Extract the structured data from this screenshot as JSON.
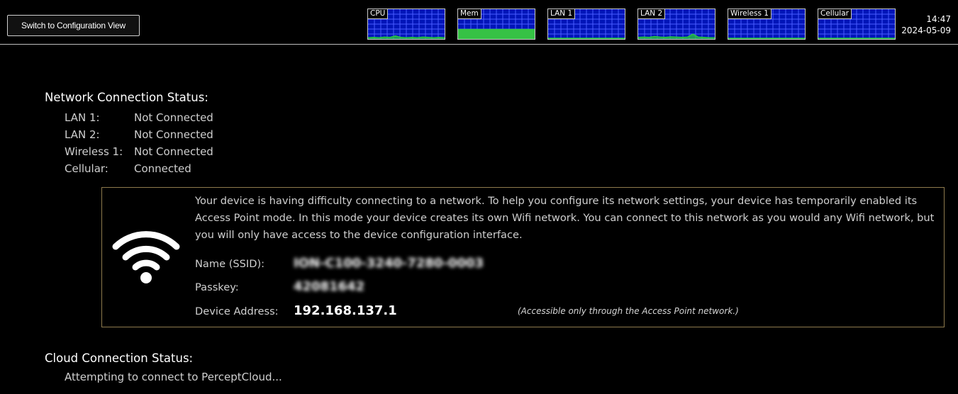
{
  "topbar": {
    "switch_button_label": "Switch to Configuration View",
    "clock": {
      "time": "14:47",
      "date": "2024-05-09"
    },
    "monitors": [
      {
        "label": "CPU",
        "usage_series": [
          2,
          3,
          2,
          4,
          3,
          8,
          3,
          2,
          3,
          2,
          4,
          3,
          2,
          3,
          2
        ]
      },
      {
        "label": "Mem",
        "usage_series": [
          30,
          30,
          30,
          30,
          30,
          30,
          30,
          30,
          30,
          30,
          30,
          30,
          30,
          30,
          30
        ]
      },
      {
        "label": "LAN 1",
        "usage_series": [
          0,
          0,
          0,
          0,
          0,
          0,
          0,
          0,
          0,
          0,
          0,
          0,
          0,
          0,
          0
        ]
      },
      {
        "label": "LAN 2",
        "usage_series": [
          3,
          4,
          3,
          6,
          4,
          3,
          5,
          4,
          3,
          4,
          14,
          4,
          3,
          2,
          2
        ]
      },
      {
        "label": "Wireless 1",
        "usage_series": [
          0,
          0,
          0,
          0,
          0,
          0,
          0,
          0,
          0,
          0,
          0,
          0,
          0,
          0,
          0
        ]
      },
      {
        "label": "Cellular",
        "usage_series": [
          0,
          0,
          0,
          0,
          0,
          0,
          0,
          0,
          0,
          0,
          0,
          0,
          0,
          0,
          0
        ]
      }
    ],
    "colors": {
      "graph_bg": "#0015b8",
      "graph_grid": "#4a5cff",
      "graph_line": "#28c83c",
      "mem_fill": "#36c245"
    }
  },
  "network": {
    "title": "Network Connection Status:",
    "connections": [
      {
        "name": "LAN 1:",
        "status": "Not Connected"
      },
      {
        "name": "LAN 2:",
        "status": "Not Connected"
      },
      {
        "name": "Wireless 1:",
        "status": "Not Connected"
      },
      {
        "name": "Cellular:",
        "status": "Connected"
      }
    ]
  },
  "access_point": {
    "icon": "wifi-icon",
    "message": "Your device is having difficulty connecting to a network.  To help you configure its network settings, your device has temporarily enabled its Access Point mode.  In this mode your device creates its own Wifi network.  You can connect to this network as you would any Wifi network, but you will only have access to the device configuration interface.",
    "ssid_label": "Name (SSID):",
    "ssid_value": "ION-C100-3240-7280-0003",
    "passkey_label": "Passkey:",
    "passkey_value": "42081642",
    "address_label": "Device Address:",
    "address_value": "192.168.137.1",
    "note": "(Accessible only through the Access Point network.)",
    "border_color": "#8e7a4d"
  },
  "cloud": {
    "title": "Cloud Connection Status:",
    "status": "Attempting to connect to PerceptCloud..."
  }
}
